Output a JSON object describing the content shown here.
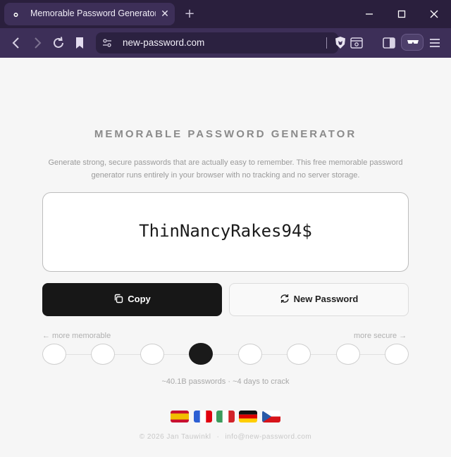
{
  "browser": {
    "tab_title": "Memorable Password Generator",
    "tab_close": "✕",
    "new_tab": "+",
    "url": "new-password.com"
  },
  "page": {
    "heading": "MEMORABLE PASSWORD GENERATOR",
    "description": "Generate strong, secure passwords that are actually easy to remember. This free memorable password generator runs entirely in your browser with no tracking and no server storage.",
    "password": "ThinNancyRakes94$",
    "copy_label": "Copy",
    "new_password_label": "New Password",
    "hint_left": "← more memorable",
    "hint_right": "more secure →",
    "strength_levels": 8,
    "selected_level": 4,
    "stats": "~40.1B passwords · ~4 days to crack",
    "languages": [
      "es",
      "fr",
      "it",
      "de",
      "cz"
    ],
    "footer_copyright": "© 2026 Jan Tauwinkl",
    "footer_sep": "·",
    "footer_email": "info@new-password.com"
  },
  "colors": {
    "chrome_bg": "#2a1f3d",
    "toolbar_bg": "#3d2f58",
    "page_bg": "#f6f6f6",
    "primary_button": "#171717"
  }
}
